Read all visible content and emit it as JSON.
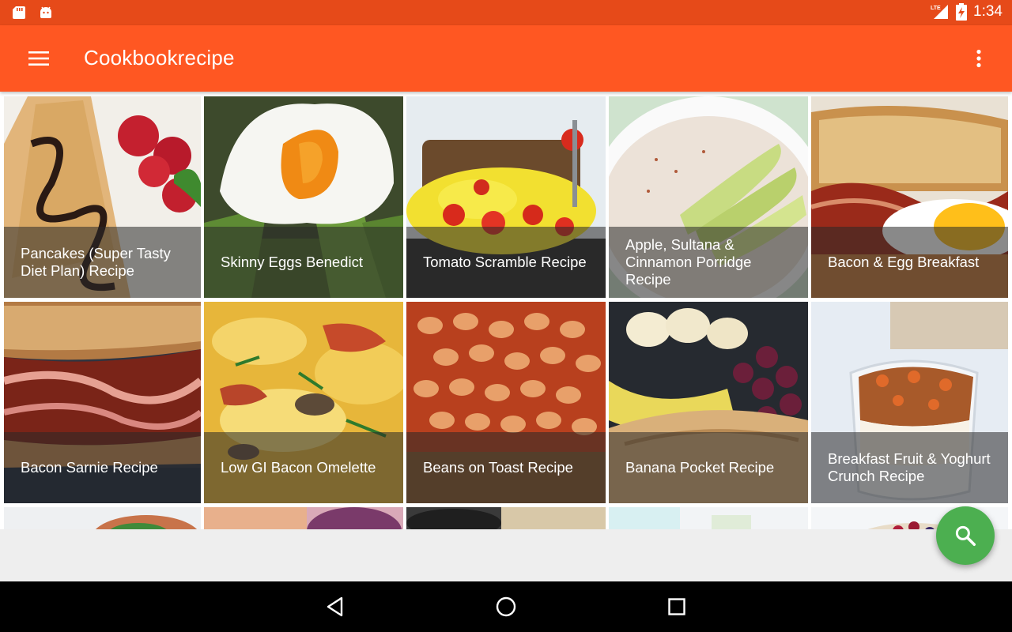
{
  "status_bar": {
    "time": "1:34",
    "network": "LTE",
    "left_icons": [
      "sd-card-icon",
      "android-icon"
    ],
    "right_icons": [
      "signal-icon",
      "battery-charging-icon"
    ]
  },
  "app_bar": {
    "title": "Cookbookrecipe",
    "color": "#ff5722",
    "status_color": "#e64a19"
  },
  "recipes": [
    {
      "title": "Pancakes (Super Tasty Diet Plan) Recipe",
      "image": "pancakes-image"
    },
    {
      "title": "Skinny Eggs Benedict",
      "image": "poached-egg-image"
    },
    {
      "title": "Tomato Scramble Recipe",
      "image": "tomato-scramble-image"
    },
    {
      "title": "Apple, Sultana & Cinnamon Porridge Recipe",
      "image": "porridge-image"
    },
    {
      "title": "Bacon & Egg Breakfast",
      "image": "bacon-egg-image"
    },
    {
      "title": "Bacon Sarnie Recipe",
      "image": "bacon-sarnie-image"
    },
    {
      "title": "Low GI Bacon Omelette",
      "image": "omelette-image"
    },
    {
      "title": "Beans on Toast Recipe",
      "image": "beans-toast-image"
    },
    {
      "title": "Banana Pocket Recipe",
      "image": "banana-pocket-image"
    },
    {
      "title": "Breakfast Fruit & Yoghurt Crunch Recipe",
      "image": "yoghurt-crunch-image"
    }
  ],
  "fab": {
    "icon": "search-icon",
    "color": "#4caf50"
  },
  "nav_bar": {
    "buttons": [
      "back-icon",
      "home-icon",
      "recents-icon"
    ]
  }
}
